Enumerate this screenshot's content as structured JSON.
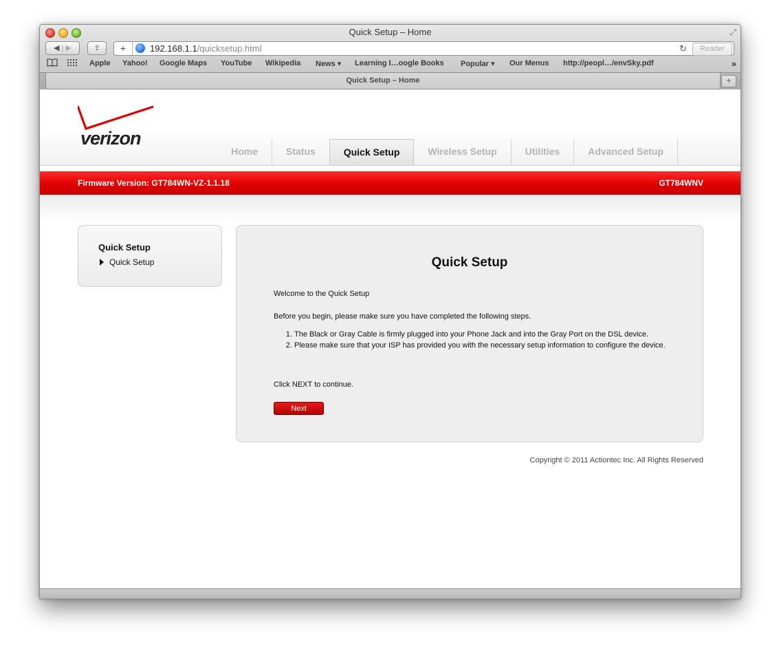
{
  "window": {
    "title": "Quick Setup – Home"
  },
  "toolbar": {
    "back_icon": "back-arrow",
    "forward_icon": "forward-arrow",
    "url_host": "192.168.1.1",
    "url_path": "/quicksetup.html",
    "reader_label": "Reader"
  },
  "bookmarks": {
    "items": [
      "Apple",
      "Yahoo!",
      "Google Maps",
      "YouTube",
      "Wikipedia",
      "News ▾",
      "Learning I…oogle Books",
      "Popular ▾",
      "Our Menus",
      "http://peopl…/envSky.pdf"
    ]
  },
  "tab": {
    "title": "Quick Setup – Home"
  },
  "logo": {
    "text": "verizon"
  },
  "nav": {
    "items": [
      "Home",
      "Status",
      "Quick Setup",
      "Wireless Setup",
      "Utilities",
      "Advanced Setup"
    ],
    "active": "Quick Setup"
  },
  "banner": {
    "firmware": "Firmware Version: GT784WN-VZ-1.1.18",
    "model": "GT784WNV"
  },
  "sidebar": {
    "title": "Quick Setup",
    "item": "Quick Setup"
  },
  "content": {
    "title": "Quick Setup",
    "welcome": "Welcome to the Quick Setup",
    "intro": "Before you begin, please make sure you have completed the following steps.",
    "steps": [
      "The Black or Gray Cable is firmly plugged into your Phone Jack and into the Gray Port on the DSL device.",
      "Please make sure that your ISP has provided you with the necessary setup information to configure the device."
    ],
    "continue_text": "Click NEXT to continue.",
    "next_label": "Next"
  },
  "footer": {
    "copyright": "Copyright © 2011 Actiontec Inc. All Rights Reserved"
  },
  "colors": {
    "brand_red": "#e00000",
    "panel_gray": "#efeeef"
  }
}
